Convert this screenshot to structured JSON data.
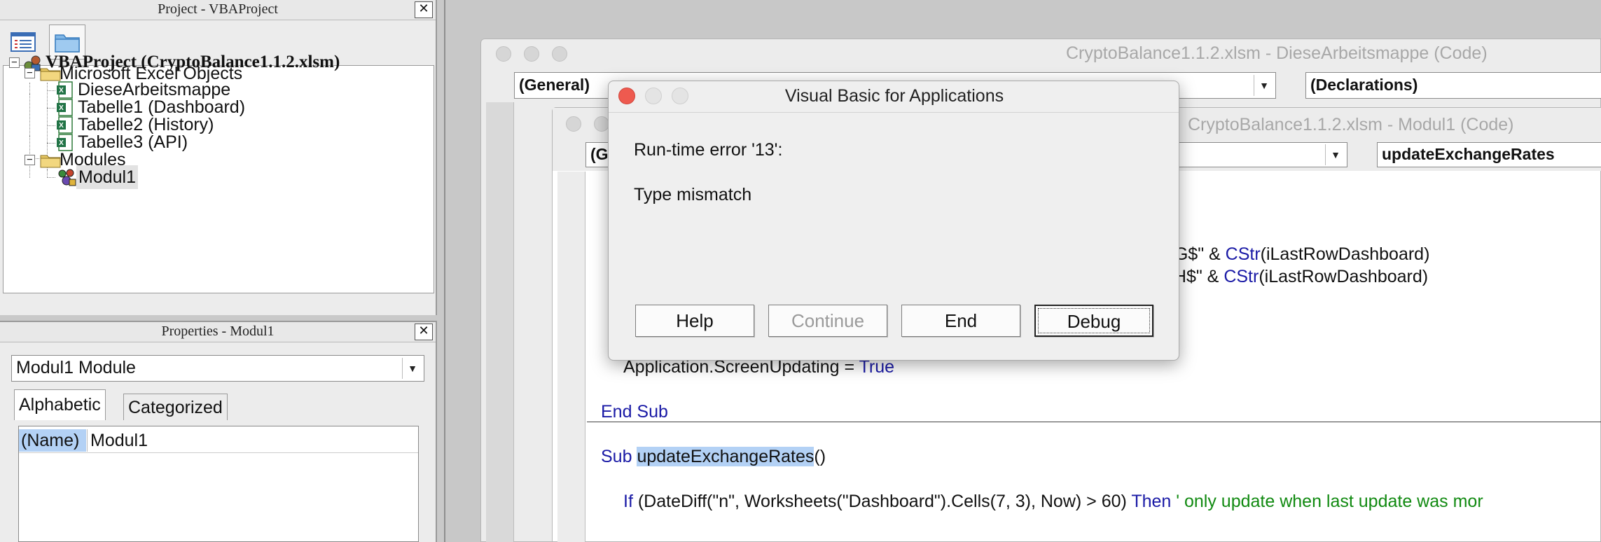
{
  "project_pane": {
    "title": "Project - VBAProject",
    "tree": {
      "root": "VBAProject (CryptoBalance1.1.2.xlsm)",
      "excel_objects_folder": "Microsoft Excel Objects",
      "excel_objects": [
        "DieseArbeitsmappe",
        "Tabelle1 (Dashboard)",
        "Tabelle2 (History)",
        "Tabelle3 (API)"
      ],
      "modules_folder": "Modules",
      "modules": [
        "Modul1"
      ]
    }
  },
  "properties_pane": {
    "title": "Properties - Modul1",
    "object_combo": "Modul1 Module",
    "tabs": [
      "Alphabetic",
      "Categorized"
    ],
    "rows": [
      {
        "name": "(Name)",
        "value": "Modul1"
      }
    ]
  },
  "code_window_back": {
    "title": "CryptoBalance1.1.2.xlsm - DieseArbeitsmappe (Code)",
    "object_combo": "(General)",
    "proc_combo": "(Declarations)"
  },
  "code_window_front": {
    "title": "CryptoBalance1.1.2.xlsm - Modul1 (Code)",
    "object_combo_partial": "(G",
    "proc_combo": "updateExchangeRates",
    "code": {
      "l1_a": ":$G$\" & ",
      "l1_kw": "CStr",
      "l1_b": "(iLastRowDashboard)",
      "l2_a": "$H$\" & ",
      "l2_kw": "CStr",
      "l2_b": "(iLastRowDashboard)",
      "l3_a": "Application.ScreenUpdating = ",
      "l3_kw": "True",
      "l4": "End Sub",
      "l5_kw": "Sub ",
      "l5_name": "updateExchangeRates",
      "l5_b": "()",
      "l6_kw1": "If ",
      "l6_a": "(DateDiff(\"n\", Worksheets(\"Dashboard\").Cells(7, 3), Now) > 60) ",
      "l6_kw2": "Then",
      "l6_cm": "  ' only update when last update was mor"
    }
  },
  "dialog": {
    "title": "Visual Basic for Applications",
    "error": "Run-time error '13':",
    "message": "Type mismatch",
    "buttons": {
      "help": "Help",
      "continue": "Continue",
      "end": "End",
      "debug": "Debug"
    }
  },
  "colors": {
    "keyword": "#1a1aa6",
    "comment": "#118a11",
    "selection": "#b3d1f5",
    "close_red": "#ee5a4f"
  },
  "icons": [
    "vba-project-icon",
    "folder-icon",
    "excel-sheet-icon",
    "module-icon",
    "view-code-icon",
    "toggle-folders-icon",
    "close-icon",
    "chevron-down-icon"
  ]
}
